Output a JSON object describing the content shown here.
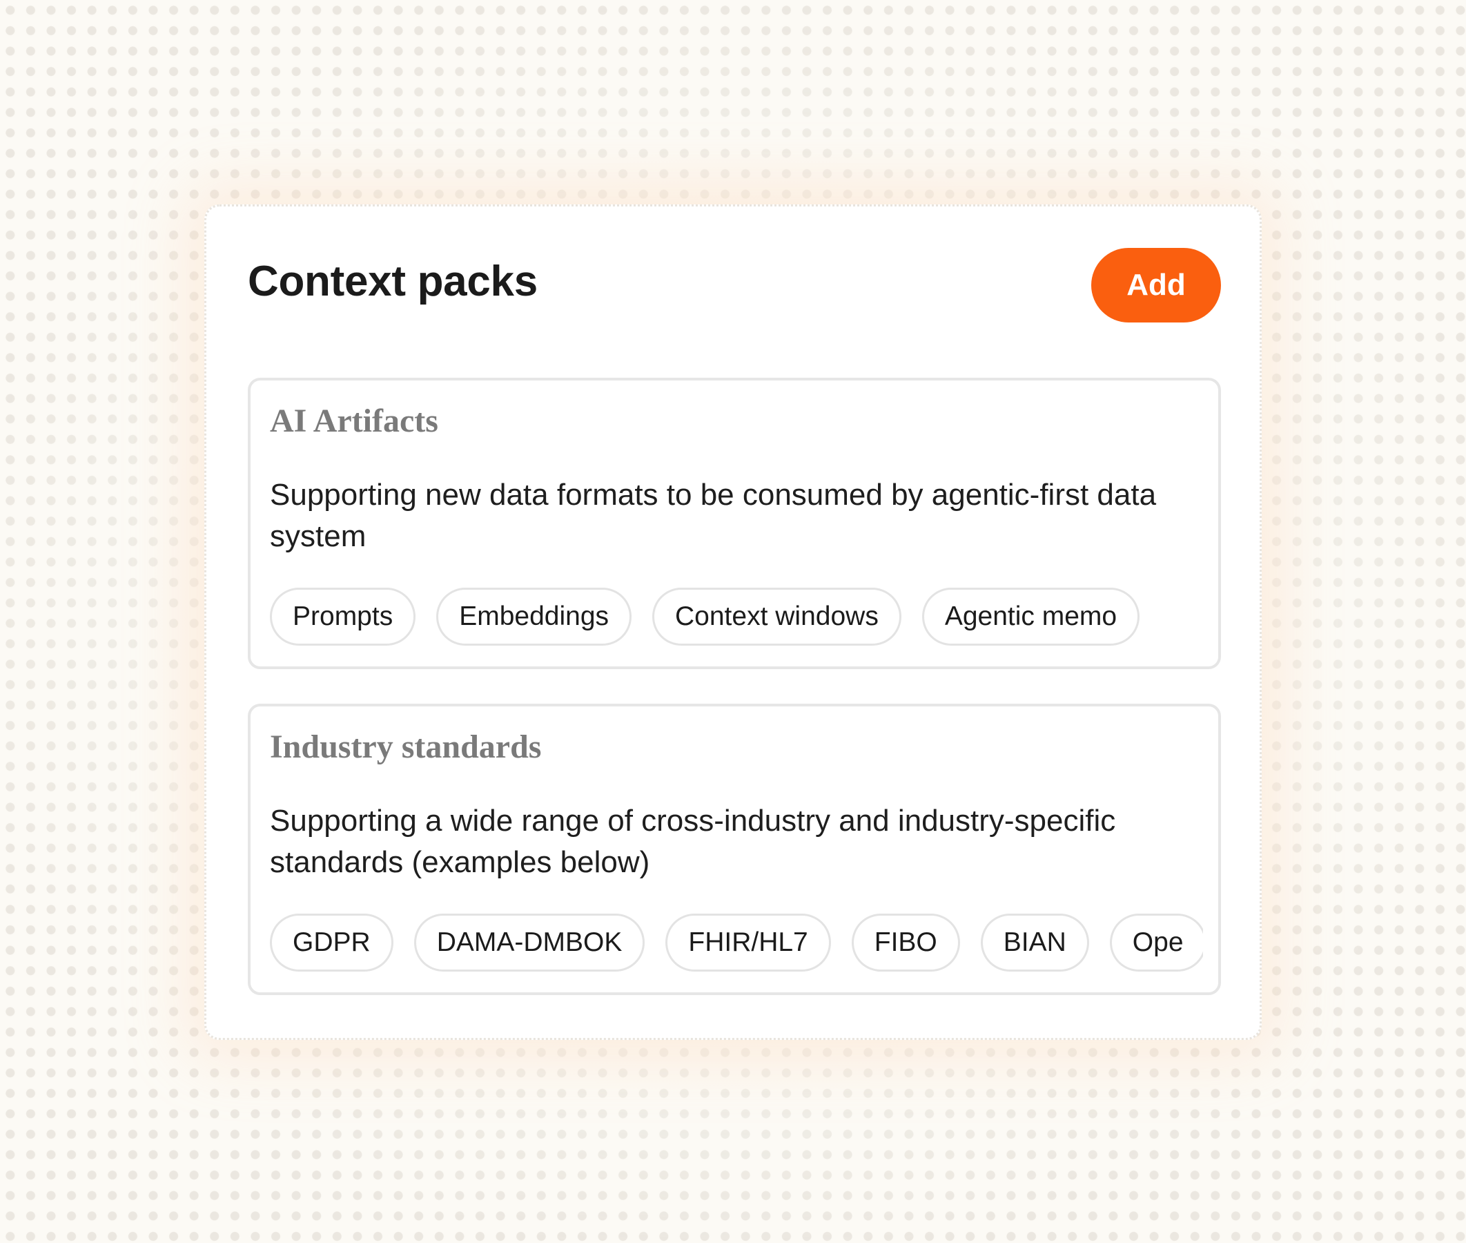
{
  "panel": {
    "title": "Context packs",
    "add_label": "Add"
  },
  "colors": {
    "accent": "#fa5f0f",
    "background": "#fcfaf5",
    "card": "#ffffff"
  },
  "packs": [
    {
      "title": "AI Artifacts",
      "description": "Supporting new data formats to be consumed by agentic-first data system",
      "tags": [
        "Prompts",
        "Embeddings",
        "Context windows",
        "Agentic memo"
      ]
    },
    {
      "title": "Industry standards",
      "description": "Supporting a wide range of cross-industry and industry-specific standards (examples below)",
      "tags": [
        "GDPR",
        "DAMA-DMBOK",
        "FHIR/HL7",
        "FIBO",
        "BIAN",
        "Ope"
      ]
    }
  ]
}
